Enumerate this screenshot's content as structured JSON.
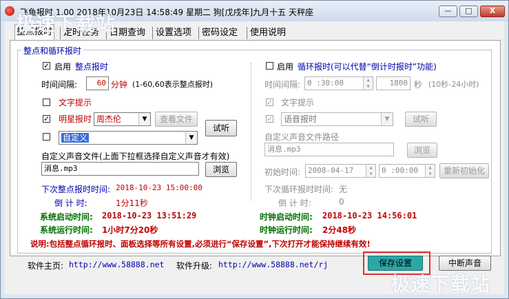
{
  "window": {
    "title": "飞鱼报时 1.00 2018年10月23日 14:58:49 星期二 狗[戊戌年]九月十五 天秤座",
    "min_glyph": "—",
    "max_glyph": "□",
    "close_glyph": "X"
  },
  "tabs": [
    "整点报时",
    "定时任务",
    "日期查询",
    "设置选项",
    "密码设定",
    "使用说明"
  ],
  "group_title": "整点和循环报时",
  "left": {
    "enable_label": "启用",
    "enable_name": "整点报时",
    "interval_label": "时间间隔:",
    "interval_value": "60",
    "interval_unit": "分钟",
    "interval_hint": "(1-60,60表示整点报时)",
    "text_tip_label": "文字提示",
    "star_label": "明星报时",
    "star_select": "周杰伦",
    "view_file_btn": "查看文件",
    "custom_select": "自定义",
    "listen_btn": "试听",
    "custom_file_label": "自定义声音文件(上面下拉框选择自定义声音才有效)",
    "custom_file_value": "消息.mp3",
    "browse_btn": "浏览",
    "next_label": "下次整点报时时间:",
    "next_value": "2018-10-23 15:00:00",
    "countdown_label": "倒 计 时:",
    "countdown_value": "1分11秒"
  },
  "right": {
    "enable_label": "启用",
    "enable_name": "循环报时(可以代替“倒计时报时”功能)",
    "interval_label": "时间间隔:",
    "interval_time": "0 :30:00",
    "interval_seconds": "1800",
    "interval_unit": "秒",
    "interval_hint": "(10秒-24小时)",
    "text_tip_label": "文字提示",
    "voice_select": "语音报时",
    "listen_btn": "试听",
    "custom_path_label": "自定义声音文件路径",
    "custom_path_value": "消息.mp3",
    "browse_btn": "浏览",
    "start_label": "初始时间:",
    "start_date": "2008-04-17",
    "start_time": "0 :00:00",
    "reinit_btn": "重新初始化",
    "next_label": "下次循环报时时间:",
    "next_value": "无",
    "countdown_label": "倒 计 时:",
    "countdown_value": "0"
  },
  "status": {
    "sys_start_label": "系统启动时间:",
    "sys_start_value": "2018-10-23 13:51:29",
    "sys_run_label": "系统运行时间:",
    "sys_run_value": "1小时7分20秒",
    "clock_start_label": "时钟启动时间:",
    "clock_start_value": "2018-10-23 14:56:01",
    "clock_run_label": "时钟运行时间:",
    "clock_run_value": "2分48秒"
  },
  "notice": "说明:包括整点循环报时、面板选择等所有设置,必须进行“保存设置”,下次打开才能保持继续有效!",
  "footer": {
    "home_label": "软件主页:",
    "home_url": "http://www.58888.net",
    "upgrade_label": "软件升级:",
    "upgrade_url": "http://www.58888.net/rj",
    "save_btn": "保存设置",
    "stop_btn": "中断声音"
  },
  "watermark": "极速下载站",
  "colors": {
    "highlight_border": "#e03030",
    "save_btn_bg": "#2aa8a8",
    "group_title": "#0000a0",
    "status_green": "#007000",
    "time_red": "#c00000"
  }
}
